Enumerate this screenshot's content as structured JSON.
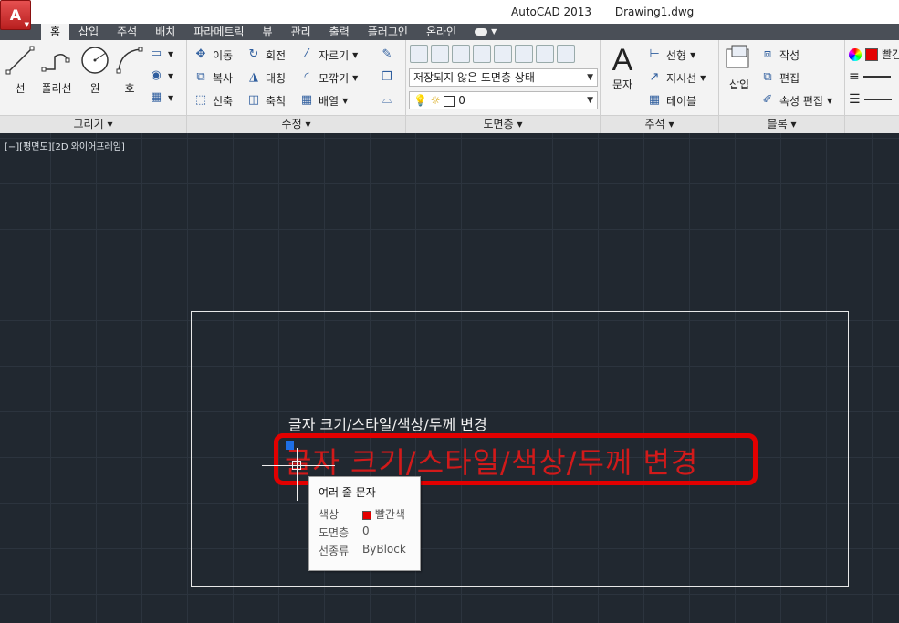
{
  "title": {
    "app": "AutoCAD 2013",
    "file": "Drawing1.dwg",
    "app_button": "A"
  },
  "tabs": [
    "홈",
    "삽입",
    "주석",
    "배치",
    "파라메트릭",
    "뷰",
    "관리",
    "출력",
    "플러그인",
    "온라인"
  ],
  "ribbon": {
    "draw": {
      "title": "그리기",
      "line": "선",
      "polyline": "폴리선",
      "circle": "원",
      "arc": "호"
    },
    "modify": {
      "title": "수정",
      "move": "이동",
      "rotate": "회전",
      "trim": "자르기",
      "copy": "복사",
      "mirror": "대칭",
      "fillet": "모깎기",
      "stretch": "신축",
      "scale": "축척",
      "array": "배열"
    },
    "layers": {
      "title": "도면층",
      "state": "저장되지 않은 도면층 상태",
      "current_layer": "0"
    },
    "annotation": {
      "title": "주석",
      "text": "문자",
      "linear": "선형",
      "leader": "지시선",
      "table": "테이블"
    },
    "block": {
      "title": "블록",
      "insert": "삽입",
      "create": "작성",
      "edit": "편집",
      "edit_attributes": "속성 편집"
    },
    "properties": {
      "color": "빨간색"
    }
  },
  "viewport": {
    "label": "[−][평면도][2D 와이어프레임]"
  },
  "drawing": {
    "text_small": "글자 크기/스타일/색상/두께 변경",
    "text_large": "글자 크기/스타일/색상/두께 변경"
  },
  "tooltip": {
    "title": "여러 줄 문자",
    "rows": [
      {
        "label": "색상",
        "value": "빨간색"
      },
      {
        "label": "도면층",
        "value": "0"
      },
      {
        "label": "선종류",
        "value": "ByBlock"
      }
    ]
  },
  "colors": {
    "canvas": "#212830",
    "highlight": "#e20000",
    "text_red": "#d11a1a",
    "grip": "#1e6fe6"
  }
}
